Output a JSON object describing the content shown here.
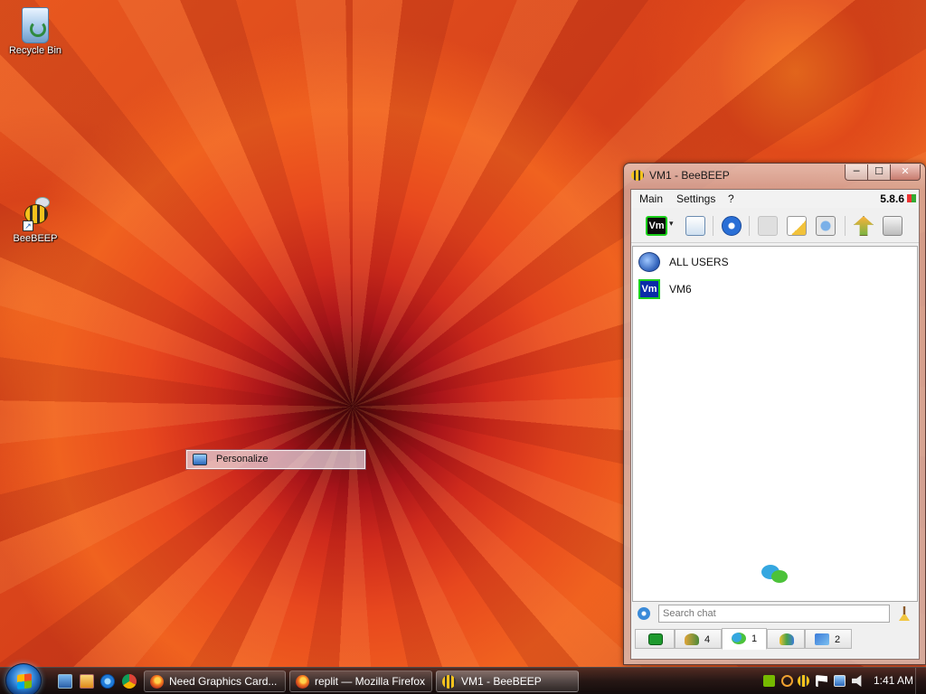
{
  "desktop": {
    "icons": [
      {
        "label": "Recycle Bin",
        "icon": "recycle-bin-icon"
      },
      {
        "label": "BeeBEEP",
        "icon": "bee-icon"
      }
    ],
    "context_menu": {
      "items": [
        {
          "label": "Personalize",
          "icon": "personalize-icon"
        }
      ]
    }
  },
  "window": {
    "title": "VM1 - BeeBEEP",
    "controls": {
      "minimize": "─",
      "maximize": "☐",
      "close": "✕"
    },
    "menu": [
      "Main",
      "Settings",
      "?"
    ],
    "version": "5.8.6",
    "toolbar": {
      "profile_label": "Vm",
      "caret": "▾",
      "buttons": [
        "edit-profile-icon",
        "network-icon",
        "mail-icon",
        "note-icon",
        "tools-icon",
        "upload-icon",
        "trash-icon"
      ]
    },
    "users": [
      {
        "label": "ALL USERS",
        "icon": "all-users-icon"
      },
      {
        "label": "VM6",
        "icon": "vm-user-icon",
        "avatar": "Vm"
      }
    ],
    "search": {
      "placeholder": "Search chat",
      "value": ""
    },
    "tabs": [
      {
        "icon": "home-icon",
        "count": ""
      },
      {
        "icon": "users-icon",
        "count": "4"
      },
      {
        "icon": "chats-icon",
        "count": "1",
        "active": true
      },
      {
        "icon": "groups-icon",
        "count": ""
      },
      {
        "icon": "file-sharing-icon",
        "count": "2"
      }
    ]
  },
  "taskbar": {
    "quick_launch": [
      "show-desktop-icon",
      "media-player-icon",
      "internet-explorer-icon",
      "chrome-icon"
    ],
    "tasks": [
      {
        "label": "Need Graphics Card...",
        "icon": "firefox-icon"
      },
      {
        "label": "replit — Mozilla Firefox",
        "icon": "firefox-icon"
      },
      {
        "label": "VM1 - BeeBEEP",
        "icon": "bee-icon",
        "active": true
      }
    ],
    "tray": [
      "nvidia-icon",
      "search-icon",
      "bee-icon",
      "flag-icon",
      "network-icon",
      "volume-icon"
    ],
    "clock": "1:41 AM"
  }
}
